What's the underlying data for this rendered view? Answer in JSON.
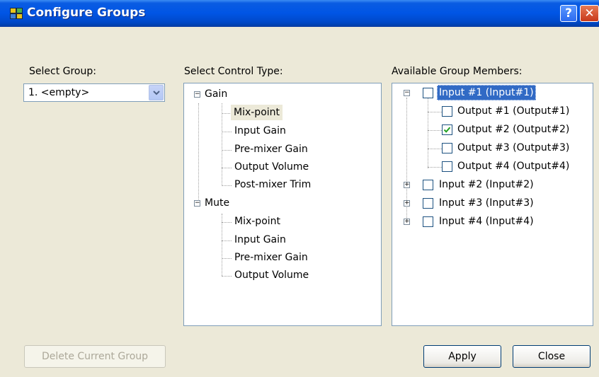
{
  "window": {
    "title": "Configure Groups",
    "help_glyph": "?",
    "close_glyph": "✕"
  },
  "select_group": {
    "label": "Select Group:",
    "value": "1. <empty>"
  },
  "control_type": {
    "label": "Select Control Type:",
    "items": [
      {
        "label": "Gain",
        "children": [
          "Mix-point",
          "Input Gain",
          "Pre-mixer Gain",
          "Output Volume",
          "Post-mixer Trim"
        ]
      },
      {
        "label": "Mute",
        "children": [
          "Mix-point",
          "Input Gain",
          "Pre-mixer Gain",
          "Output Volume"
        ]
      }
    ],
    "highlighted": "Mix-point"
  },
  "members": {
    "label": "Available Group Members:",
    "input1": "Input #1 (Input#1)",
    "outputs": [
      {
        "label": "Output #1 (Output#1)",
        "checked": false
      },
      {
        "label": "Output #2 (Output#2)",
        "checked": true
      },
      {
        "label": "Output #3 (Output#3)",
        "checked": false
      },
      {
        "label": "Output #4 (Output#4)",
        "checked": false
      }
    ],
    "inputs_collapsed": [
      "Input #2 (Input#2)",
      "Input #3 (Input#3)",
      "Input #4 (Input#4)"
    ]
  },
  "buttons": {
    "delete": "Delete Current Group",
    "apply": "Apply",
    "close": "Close"
  },
  "icons": {
    "app": "groups-icon",
    "dropdown": "chevron-down-icon",
    "check": "checkmark-icon",
    "expand": "plus-icon",
    "collapse": "minus-icon"
  },
  "colors": {
    "titlebar": "#0055e5",
    "selection": "#316ac5",
    "check": "#21a121",
    "face": "#ece9d8"
  }
}
